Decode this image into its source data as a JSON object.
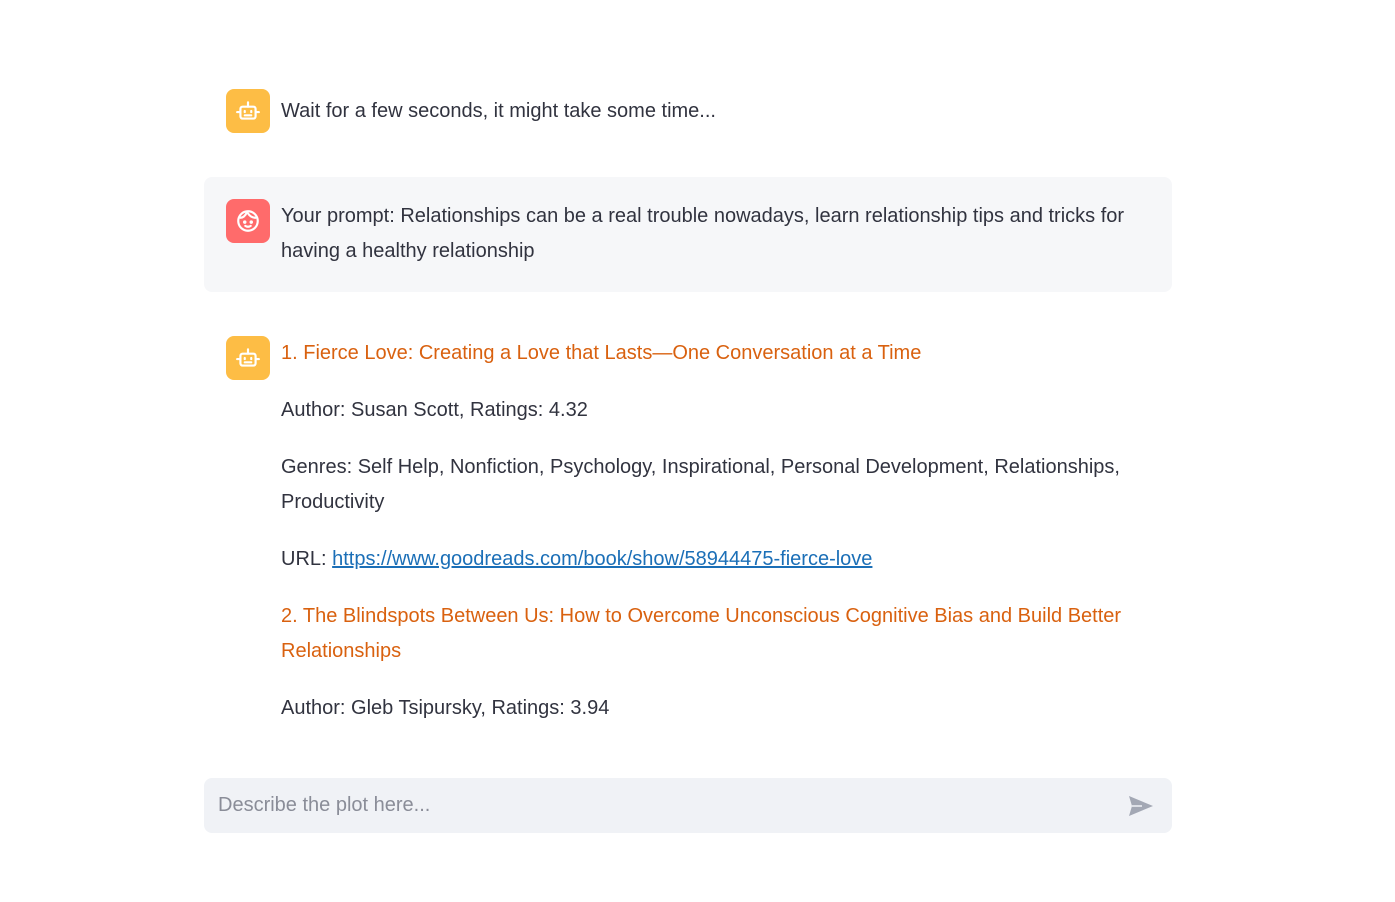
{
  "messages": {
    "status": {
      "avatar_icon": "robot-icon",
      "text": "Wait for a few seconds, it might take some time..."
    },
    "prompt": {
      "avatar_icon": "face-icon",
      "text": "Your prompt: Relationships can be a real trouble nowadays, learn relationship tips and tricks for having a healthy relationship"
    },
    "results": {
      "avatar_icon": "robot-icon",
      "books": [
        {
          "title": "1. Fierce Love: Creating a Love that Lasts—One Conversation at a Time",
          "author_line": "Author: Susan Scott, Ratings: 4.32",
          "genres_line": "Genres: Self Help, Nonfiction, Psychology, Inspirational, Personal Development, Relationships, Productivity",
          "url_label": "URL: ",
          "url": "https://www.goodreads.com/book/show/58944475-fierce-love"
        },
        {
          "title": "2. The Blindspots Between Us: How to Overcome Unconscious Cognitive Bias and Build Better Relationships",
          "author_line": "Author: Gleb Tsipursky, Ratings: 3.94"
        }
      ]
    }
  },
  "chat_input": {
    "placeholder": "Describe the plot here...",
    "send_icon": "send-icon"
  },
  "colors": {
    "bot_avatar": "#fdbd45",
    "user_avatar": "#ff6b6b",
    "accent_text": "#d9610f",
    "link": "#1b6fb7"
  }
}
